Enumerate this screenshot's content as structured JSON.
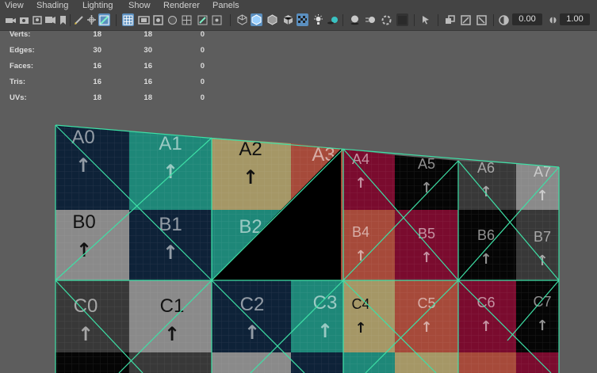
{
  "menu": [
    "View",
    "Shading",
    "Lighting",
    "Show",
    "Renderer",
    "Panels"
  ],
  "toolbar": {
    "field_1": "0.00",
    "field_2": "1.00"
  },
  "hud": {
    "rows": [
      {
        "label": "Verts:",
        "v1": "18",
        "v2": "18",
        "v3": "0"
      },
      {
        "label": "Edges:",
        "v1": "30",
        "v2": "30",
        "v3": "0"
      },
      {
        "label": "Faces:",
        "v1": "16",
        "v2": "16",
        "v3": "0"
      },
      {
        "label": "Tris:",
        "v1": "16",
        "v2": "16",
        "v3": "0"
      },
      {
        "label": "UVs:",
        "v1": "18",
        "v2": "18",
        "v3": "0"
      }
    ]
  },
  "texture": {
    "cells": [
      "A0",
      "A1",
      "A2",
      "A3",
      "A4",
      "A5",
      "A6",
      "A7",
      "B0",
      "B1",
      "B2",
      "B4",
      "B5",
      "B6",
      "B7",
      "C0",
      "C1",
      "C2",
      "C3",
      "C4",
      "C5",
      "C6",
      "C7"
    ],
    "arrow": "↑"
  },
  "colors": {
    "wireframe": "#3ee0a6",
    "viewport_bg": "#5d5d5d",
    "navy": "#0e2238",
    "teal": "#1e8778",
    "khaki": "#a59766",
    "rust": "#a64a3a",
    "maroon": "#7a0b2e",
    "black": "#050505",
    "dark_gray": "#383838",
    "light_gray": "#8a8a8a"
  }
}
